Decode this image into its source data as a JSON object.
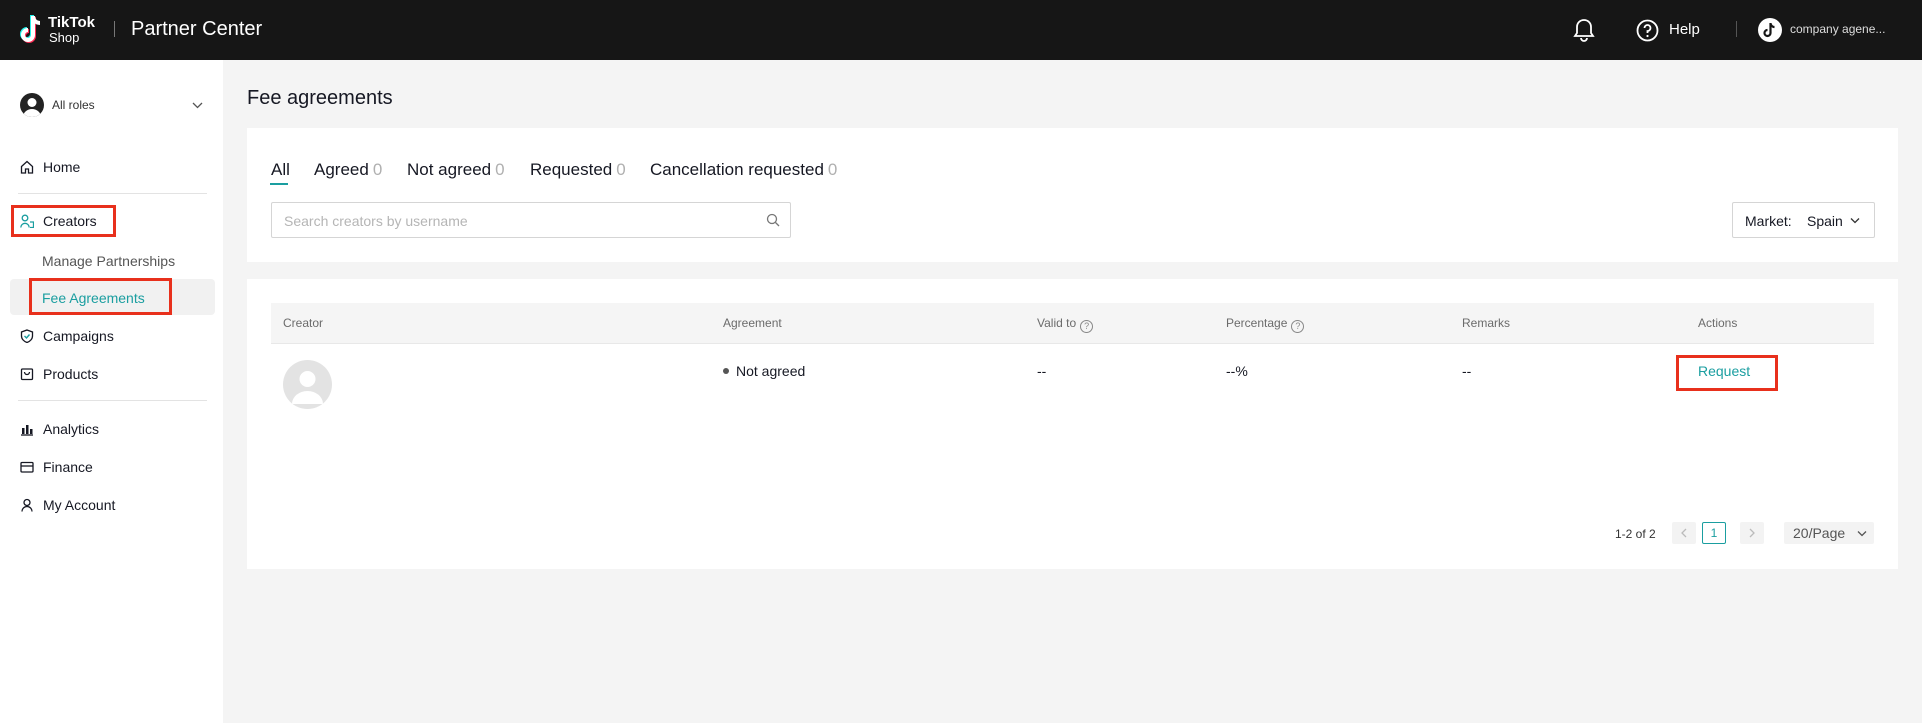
{
  "app": {
    "logo_line1": "TikTok",
    "logo_line2": "Shop",
    "title": "Partner Center",
    "help": "Help",
    "account_name": "company agene..."
  },
  "sidebar": {
    "roles": "All roles",
    "items": {
      "home": "Home",
      "creators": "Creators",
      "manage_partnerships": "Manage Partnerships",
      "fee_agreements": "Fee Agreements",
      "campaigns": "Campaigns",
      "products": "Products",
      "analytics": "Analytics",
      "finance": "Finance",
      "my_account": "My Account"
    }
  },
  "page": {
    "title": "Fee agreements",
    "tabs": [
      {
        "label": "All",
        "count": ""
      },
      {
        "label": "Agreed",
        "count": "0"
      },
      {
        "label": "Not agreed",
        "count": "0"
      },
      {
        "label": "Requested",
        "count": "0"
      },
      {
        "label": "Cancellation requested",
        "count": "0"
      }
    ],
    "search_placeholder": "Search creators by username",
    "market_label": "Market:",
    "market_value": "Spain"
  },
  "table": {
    "headers": {
      "creator": "Creator",
      "agreement": "Agreement",
      "valid_to": "Valid to",
      "percentage": "Percentage",
      "remarks": "Remarks",
      "actions": "Actions"
    },
    "rows": [
      {
        "agreement": "Not agreed",
        "valid_to": "--",
        "percentage": "--%",
        "remarks": "--",
        "action": "Request"
      }
    ]
  },
  "pagination": {
    "summary": "1-2 of 2",
    "current_page": "1",
    "page_size": "20/Page"
  },
  "colors": {
    "accent": "#1a9ea0",
    "highlight": "#e8301c",
    "topbar": "#161616"
  }
}
